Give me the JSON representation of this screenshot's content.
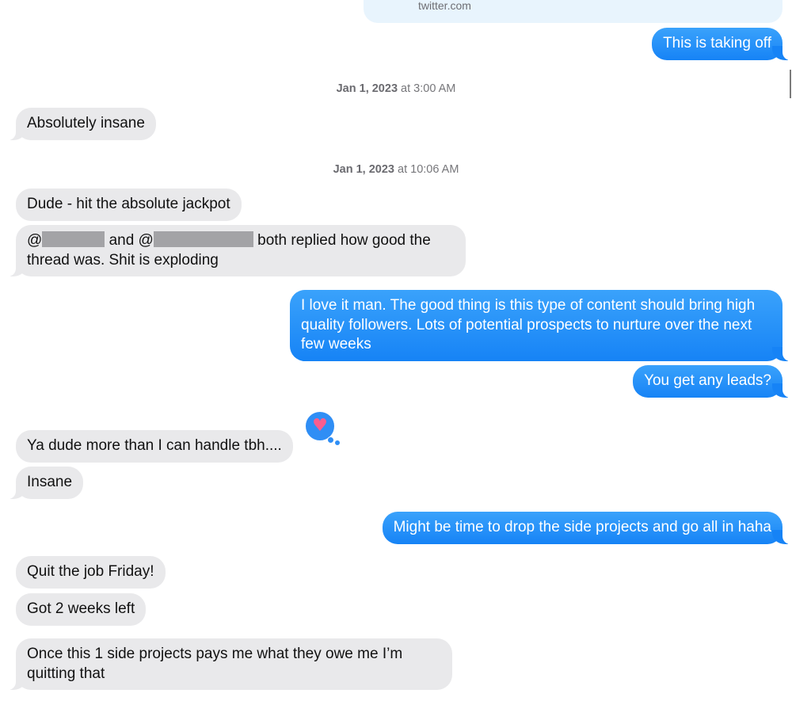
{
  "link_preview": {
    "domain": "twitter.com"
  },
  "messages": {
    "m1": "This is taking off",
    "m2": "Absolutely insane",
    "m3": "Dude - hit the absolute jackpot",
    "m4": {
      "at1": "@",
      "and": "and @",
      "rest": "both replied how good the",
      "line2": "thread was. Shit is exploding"
    },
    "m5": "I love it man. The good thing is this type of content should bring high quality followers. Lots of potential prospects to nurture over the next few weeks",
    "m6": "You get any leads?",
    "m7": "Ya dude more than I can handle tbh....",
    "m8": "Insane",
    "m9": "Might be time to drop the side projects and go all in haha",
    "m10": "Quit the job Friday!",
    "m11": "Got 2 weeks left",
    "m12": "Once this 1 side projects pays me what they owe me I’m quitting that"
  },
  "timestamps": {
    "t1": {
      "date": "Jan 1, 2023",
      "at": "at",
      "time": "3:00 AM"
    },
    "t2": {
      "date": "Jan 1, 2023",
      "at": "at",
      "time": "10:06 AM"
    }
  },
  "reaction": {
    "icon": "heart-icon",
    "color": "#fb5d8e"
  },
  "colors": {
    "outgoing": "#1683f6",
    "incoming": "#e9e9eb",
    "link_card": "#e8f4fd"
  }
}
